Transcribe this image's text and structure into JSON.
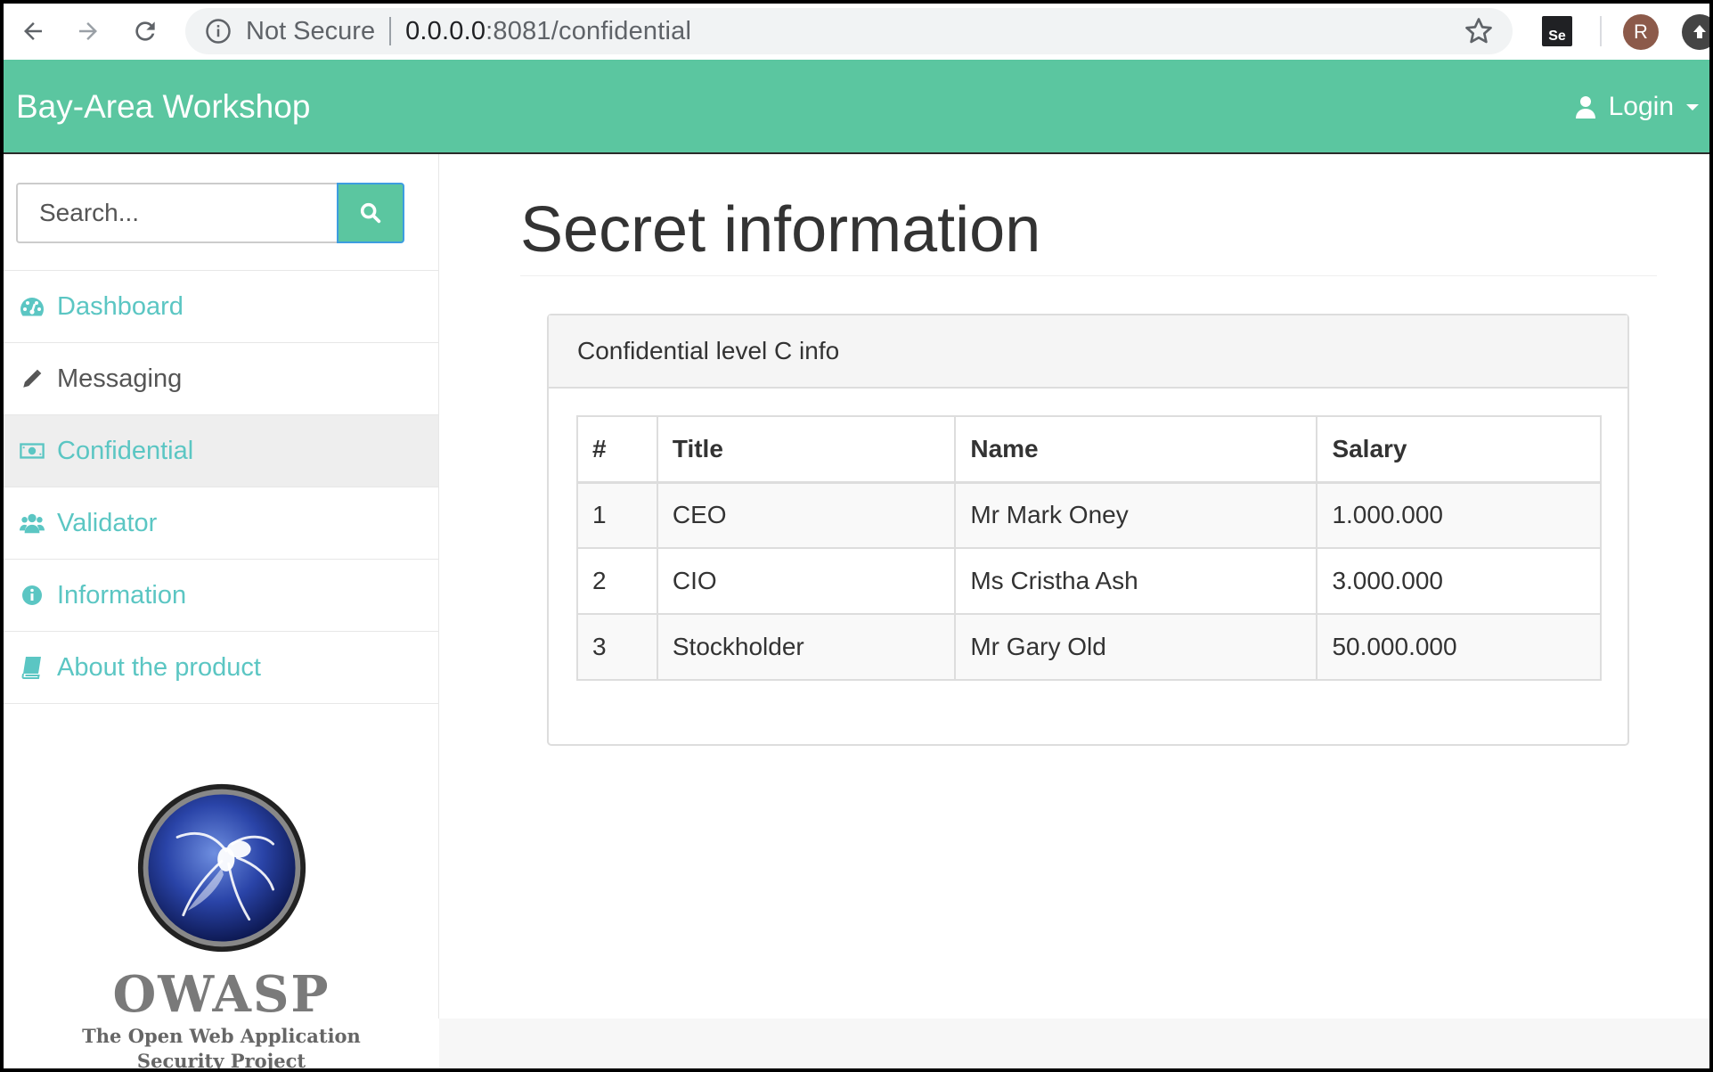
{
  "browser": {
    "security_label": "Not Secure",
    "url_host": "0.0.0.0",
    "url_rest": ":8081/confidential",
    "extension_label": "Se",
    "profile_initial": "R"
  },
  "navbar": {
    "brand": "Bay-Area Workshop",
    "login_label": "Login",
    "color": "#5bc6a0"
  },
  "sidebar": {
    "search_placeholder": "Search...",
    "items": [
      {
        "label": "Dashboard",
        "icon": "dashboard-icon",
        "active": false
      },
      {
        "label": "Messaging",
        "icon": "pencil-icon",
        "active": false
      },
      {
        "label": "Confidential",
        "icon": "money-icon",
        "active": true
      },
      {
        "label": "Validator",
        "icon": "users-icon",
        "active": false
      },
      {
        "label": "Information",
        "icon": "info-circle-icon",
        "active": false
      },
      {
        "label": "About the product",
        "icon": "book-icon",
        "active": false
      }
    ],
    "logo": {
      "wordmark": "OWASP",
      "tagline_1": "The Open Web Application",
      "tagline_2": "Security Project"
    }
  },
  "main": {
    "title": "Secret information",
    "panel_heading": "Confidential level C info",
    "table": {
      "headers": [
        "#",
        "Title",
        "Name",
        "Salary"
      ],
      "rows": [
        [
          "1",
          "CEO",
          "Mr Mark Oney",
          "1.000.000"
        ],
        [
          "2",
          "CIO",
          "Ms Cristha Ash",
          "3.000.000"
        ],
        [
          "3",
          "Stockholder",
          "Mr Gary Old",
          "50.000.000"
        ]
      ]
    }
  }
}
